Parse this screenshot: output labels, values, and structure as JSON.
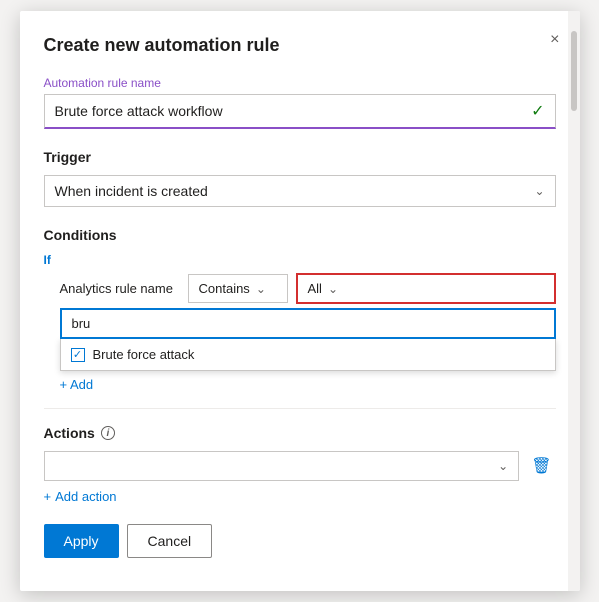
{
  "dialog": {
    "title": "Create new automation rule",
    "close_label": "×"
  },
  "automation_rule_name": {
    "label": "Automation rule name",
    "value": "Brute force attack workflow",
    "checkmark": "✓"
  },
  "trigger": {
    "label": "Trigger",
    "value": "When incident is created"
  },
  "conditions": {
    "section_label": "Conditions",
    "if_label": "If",
    "condition_label": "Analytics rule name",
    "contains_label": "Contains",
    "all_label": "All",
    "search_value": "bru",
    "dropdown_item": "Brute force attack",
    "add_condition_link": "+ Add"
  },
  "actions": {
    "section_label": "Actions",
    "add_action_label": "Add action"
  },
  "footer": {
    "apply_label": "Apply",
    "cancel_label": "Cancel"
  }
}
